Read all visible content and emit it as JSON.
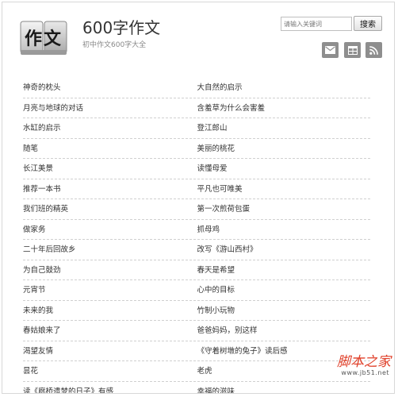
{
  "header": {
    "title": "600字作文",
    "subtitle": "初中作文600字大全",
    "logo_text": "作文"
  },
  "search": {
    "placeholder": "请输入关键词",
    "button_label": "搜索"
  },
  "share_icons": [
    "mail-icon",
    "table-icon",
    "rss-icon"
  ],
  "articles": {
    "left": [
      "神奇的枕头",
      "月亮与地球的对话",
      "水缸的启示",
      "随笔",
      "长江美景",
      "推荐一本书",
      "我们班的精英",
      "做家务",
      "二十年后回故乡",
      "为自己鼓劲",
      "元宵节",
      "未来的我",
      "春姑娘来了",
      "渴望友情",
      "昙花",
      "读《廊桥遗梦的日子》有感"
    ],
    "right": [
      "大自然的启示",
      "含羞草为什么会害羞",
      "登江郎山",
      "美丽的桃花",
      "读懂母爱",
      "平凡也可唯美",
      "第一次煎荷包蛋",
      "抓母鸡",
      "改写《游山西村》",
      "春天是希望",
      "心中的目标",
      "竹制小玩物",
      "爸爸妈妈，别这样",
      "《守着树墩的兔子》读后感",
      "老虎",
      "幸福的滋味"
    ]
  },
  "watermark": {
    "title": "脚本之家",
    "url": "www.jb51.net"
  },
  "colors": {
    "share_bg": "#8e8e8e",
    "watermark": "#e0402a"
  }
}
